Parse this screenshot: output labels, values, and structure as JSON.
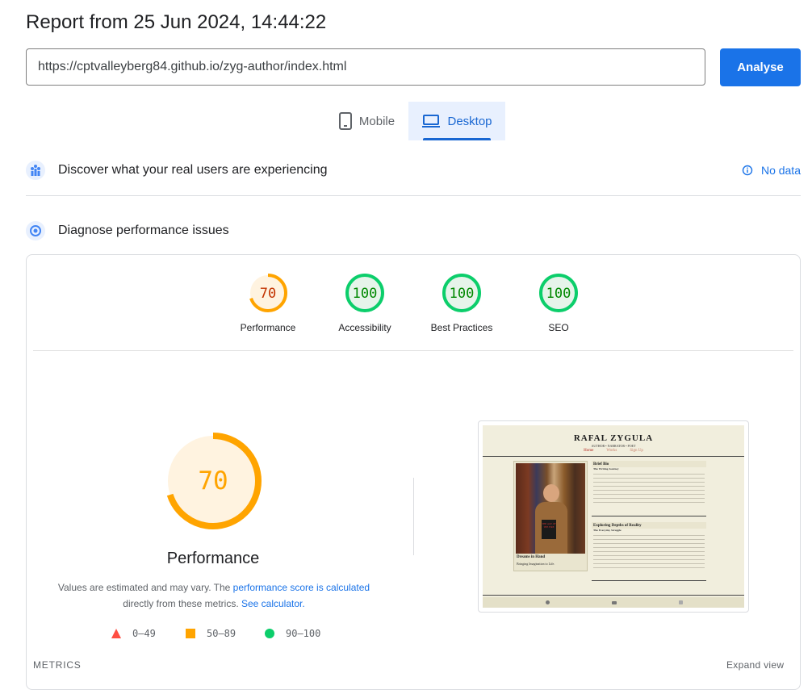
{
  "header": {
    "title": "Report from 25 Jun 2024, 14:44:22",
    "url_value": "https://cptvalleyberg84.github.io/zyg-author/index.html",
    "analyse_label": "Analyse"
  },
  "tabs": [
    {
      "label": "Mobile",
      "icon": "phone-icon",
      "selected": false
    },
    {
      "label": "Desktop",
      "icon": "laptop-icon",
      "selected": true
    }
  ],
  "sections": {
    "real_users": {
      "label": "Discover what your real users are experiencing",
      "status": "No data",
      "icon": "crux-icon"
    },
    "diagnose": {
      "label": "Diagnose performance issues",
      "icon": "lighthouse-icon"
    }
  },
  "scores": [
    {
      "label": "Performance",
      "value": "70",
      "fraction": 0.7,
      "color": "#ffa400",
      "fill": "#fff3e0",
      "text_color": "#c33300"
    },
    {
      "label": "Accessibility",
      "value": "100",
      "fraction": 1.0,
      "color": "#0cce6b",
      "fill": "#e6f4ea",
      "text_color": "#008800"
    },
    {
      "label": "Best Practices",
      "value": "100",
      "fraction": 1.0,
      "color": "#0cce6b",
      "fill": "#e6f4ea",
      "text_color": "#008800"
    },
    {
      "label": "SEO",
      "value": "100",
      "fraction": 1.0,
      "color": "#0cce6b",
      "fill": "#e6f4ea",
      "text_color": "#008800"
    }
  ],
  "performance_detail": {
    "value": "70",
    "fraction": 0.7,
    "label": "Performance",
    "desc_part1": "Values are estimated and may vary. The ",
    "desc_link1": "performance score is calculated",
    "desc_part2": "directly from these metrics. ",
    "desc_link2": "See calculator."
  },
  "legend": [
    {
      "shape": "triangle",
      "range": "0–49",
      "color": "#ff4e42"
    },
    {
      "shape": "square",
      "range": "50–89",
      "color": "#ffa400"
    },
    {
      "shape": "circle",
      "range": "90–100",
      "color": "#0cce6b"
    }
  ],
  "screenshot": {
    "site_title": "RAFAL ZYGULA",
    "tagline": "AUTHOR • NARRATOR • POET",
    "nav": [
      "Home",
      "Works",
      "Sign Up"
    ],
    "bio_heading": "Brief Bio",
    "bio_sub": "The Writing Journey",
    "depth_heading": "Exploring Depths of Reality",
    "depth_sub": "The Everyday Struggle",
    "caption_title": "Dreams in Hand",
    "caption_sub": "Bringing Imagination to Life.",
    "book_text": "THE AGE OF THE FIRE"
  },
  "footer": {
    "metrics_label": "METRICS",
    "expand_label": "Expand view"
  }
}
